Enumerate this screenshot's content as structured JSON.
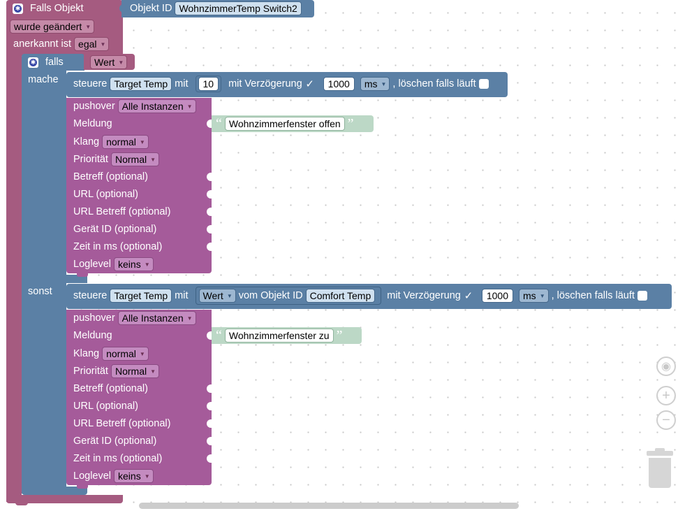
{
  "trigger": {
    "title": "Falls Objekt",
    "objekt_id_label": "Objekt ID",
    "objekt_id_value": "WohnzimmerTemp  Switch2",
    "changed_dd": "wurde geändert",
    "anerkannt_label": "anerkannt ist",
    "anerkannt_dd": "egal"
  },
  "ifblock": {
    "falls_label": "falls",
    "condition": "Wert",
    "mache_label": "mache",
    "sonst_label": "sonst"
  },
  "steuere1": {
    "steuere": "steuere",
    "target": "Target Temp",
    "mit": "mit",
    "value": "10",
    "delay_label": "mit Verzögerung",
    "check": "✓",
    "ms_value": "1000",
    "ms_unit": "ms",
    "clear_label": ", löschen falls läuft"
  },
  "steuere2": {
    "steuere": "steuere",
    "target": "Target Temp",
    "mit": "mit",
    "wert_dd": "Wert",
    "vom_label": "vom Objekt ID",
    "object": "Comfort Temp",
    "delay_label": "mit Verzögerung",
    "check": "✓",
    "ms_value": "1000",
    "ms_unit": "ms",
    "clear_label": ", löschen falls läuft"
  },
  "push1": {
    "pushover": "pushover",
    "instances": "Alle Instanzen",
    "meldung": "Meldung",
    "message": "Wohnzimmerfenster offen",
    "klang": "Klang",
    "klang_dd": "normal",
    "prioritaet": "Priorität",
    "prioritaet_dd": "Normal",
    "betreff": "Betreff (optional)",
    "url": "URL (optional)",
    "url_betreff": "URL Betreff (optional)",
    "geraet": "Gerät ID (optional)",
    "zeit": "Zeit in ms (optional)",
    "loglevel": "Loglevel",
    "loglevel_dd": "keins"
  },
  "push2": {
    "pushover": "pushover",
    "instances": "Alle Instanzen",
    "meldung": "Meldung",
    "message": "Wohnzimmerfenster zu",
    "klang": "Klang",
    "klang_dd": "normal",
    "prioritaet": "Priorität",
    "prioritaet_dd": "Normal",
    "betreff": "Betreff (optional)",
    "url": "URL (optional)",
    "url_betreff": "URL Betreff (optional)",
    "geraet": "Gerät ID (optional)",
    "zeit": "Zeit in ms (optional)",
    "loglevel": "Loglevel",
    "loglevel_dd": "keins"
  },
  "icons": {
    "arrow": "▼",
    "quote_open": "“",
    "quote_close": "”",
    "recenter": "◉",
    "zoom_in": "+",
    "zoom_out": "−"
  },
  "colors": {
    "trigger": "#a55b80",
    "pushover": "#a55b9a",
    "control": "#5b80a5",
    "text": "#bcd8c6"
  }
}
